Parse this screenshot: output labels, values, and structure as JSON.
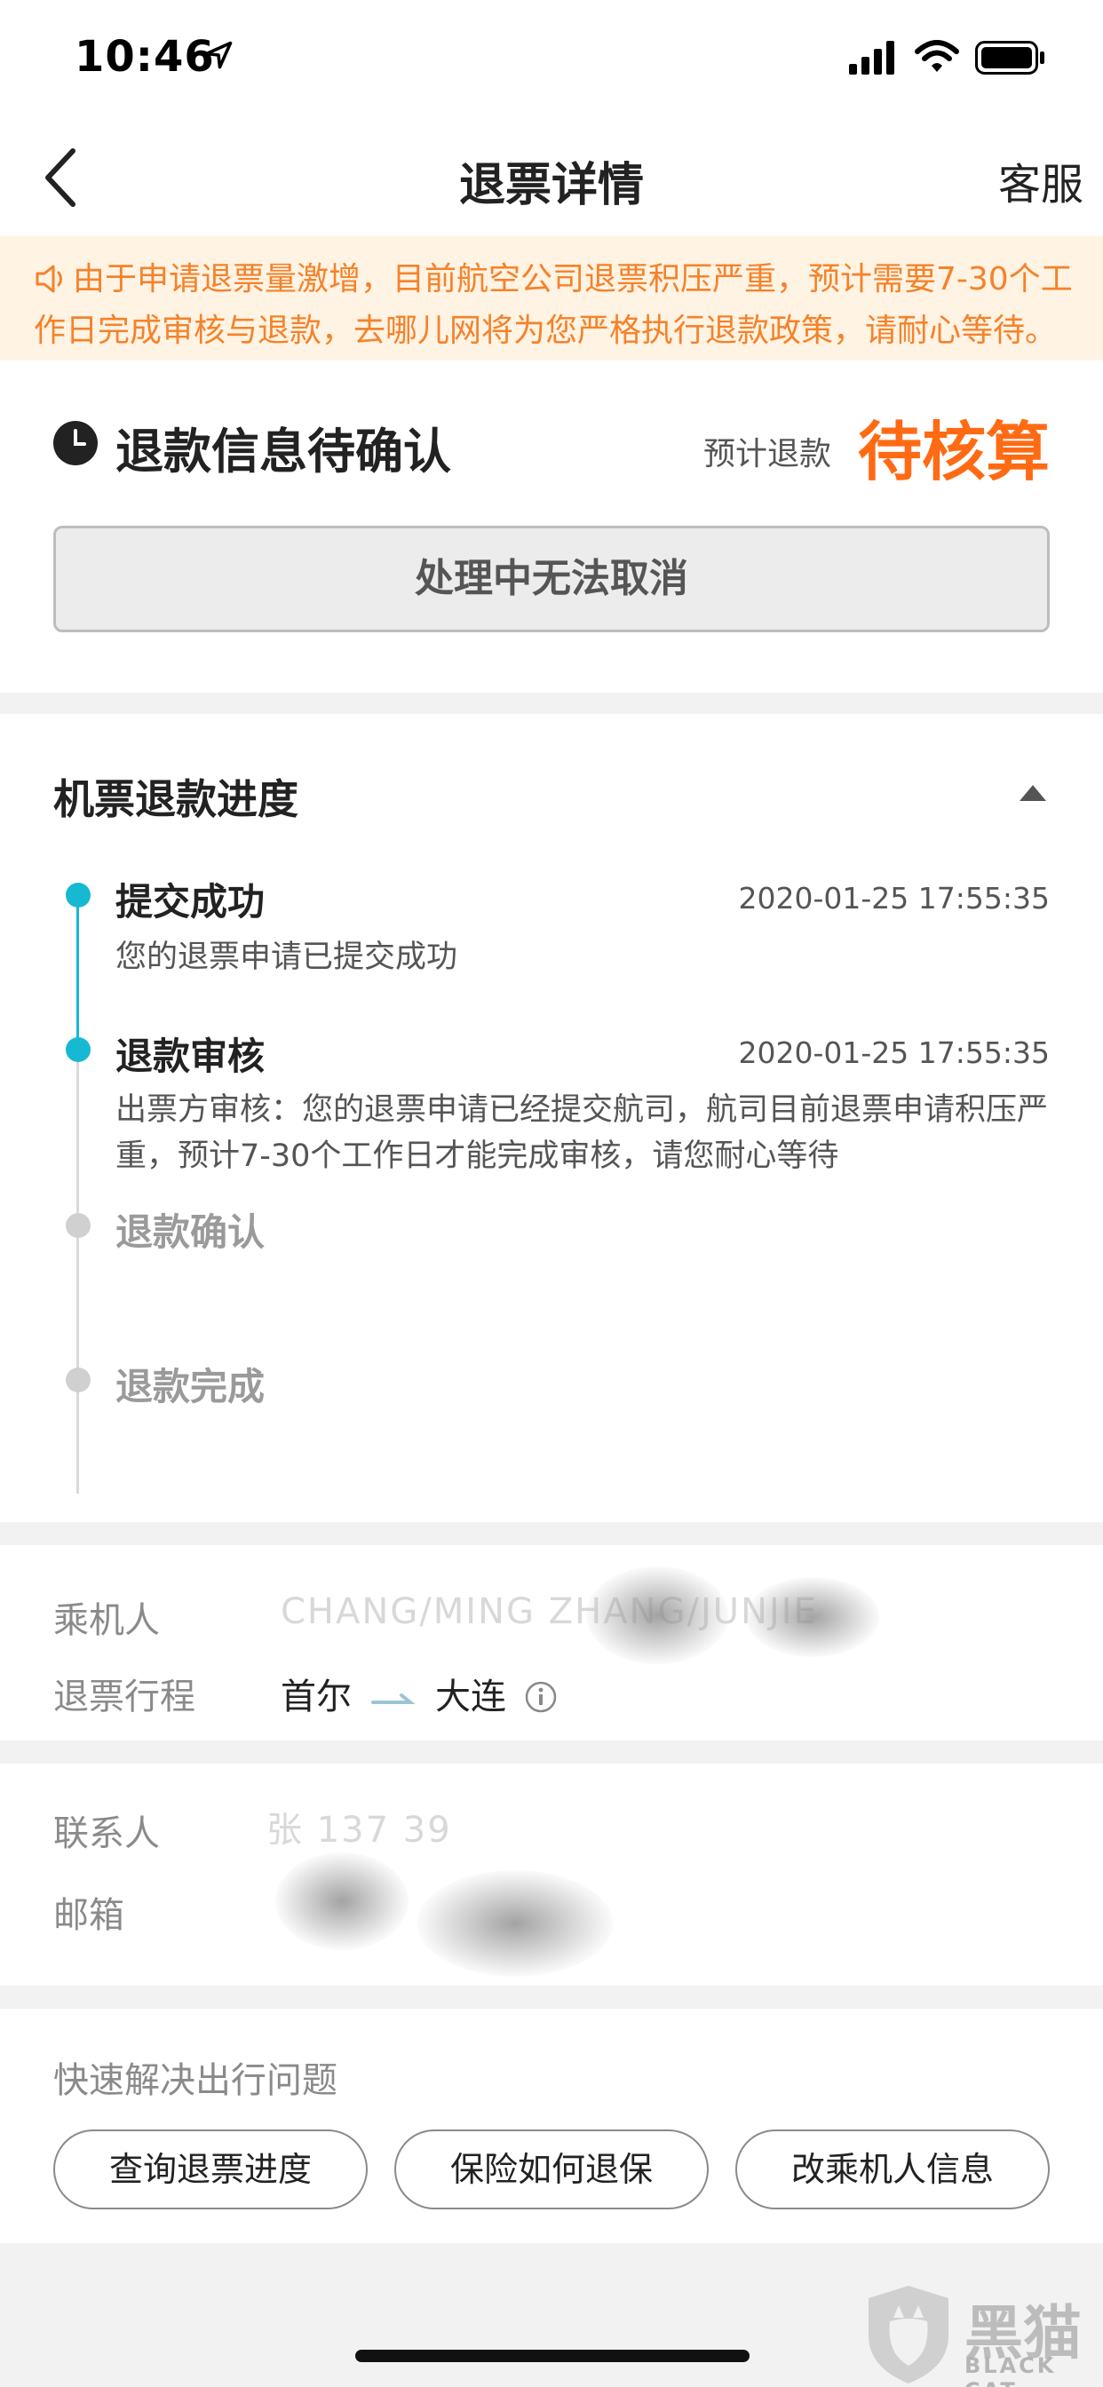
{
  "status_bar": {
    "time": "10:46"
  },
  "nav": {
    "title": "退票详情",
    "service": "客服"
  },
  "notice": {
    "text": "由于申请退票量激增，目前航空公司退票积压严重，预计需要7-30个工作日完成审核与退款，去哪儿网将为您严格执行退款政策，请耐心等待。"
  },
  "status_card": {
    "state": "退款信息待确认",
    "estimate_label": "预计退款",
    "estimate_value": "待核算",
    "button_label": "处理中无法取消"
  },
  "progress": {
    "title": "机票退款进度",
    "steps": [
      {
        "title": "提交成功",
        "time": "2020-01-25 17:55:35",
        "desc": "您的退票申请已提交成功",
        "done": true
      },
      {
        "title": "退款审核",
        "time": "2020-01-25 17:55:35",
        "desc": "出票方审核：您的退票申请已经提交航司，航司目前退票申请积压严重，预计7-30个工作日才能完成审核，请您耐心等待",
        "done": true
      },
      {
        "title": "退款确认",
        "time": "",
        "desc": "",
        "done": false
      },
      {
        "title": "退款完成",
        "time": "",
        "desc": "",
        "done": false
      }
    ]
  },
  "passenger": {
    "passenger_label": "乘机人",
    "passenger_value": "CHANG/MING  ZHANG/JUNJIE",
    "route_label": "退票行程",
    "route_from": "首尔",
    "route_to": "大连"
  },
  "contact": {
    "contact_label": "联系人",
    "contact_value": "张    137          39",
    "email_label": "邮箱",
    "email_value": ""
  },
  "quick": {
    "title": "快速解决出行问题",
    "buttons": [
      "查询退票进度",
      "保险如何退保",
      "改乘机人信息"
    ]
  },
  "watermark": {
    "cn": "黑猫",
    "en": "BLACK CAT"
  },
  "colors": {
    "accent": "#ff6a13",
    "notice_text": "#f5822a",
    "notice_bg": "#fff3e3",
    "timeline_active": "#17b8d2",
    "timeline_inactive": "#cccccc"
  }
}
